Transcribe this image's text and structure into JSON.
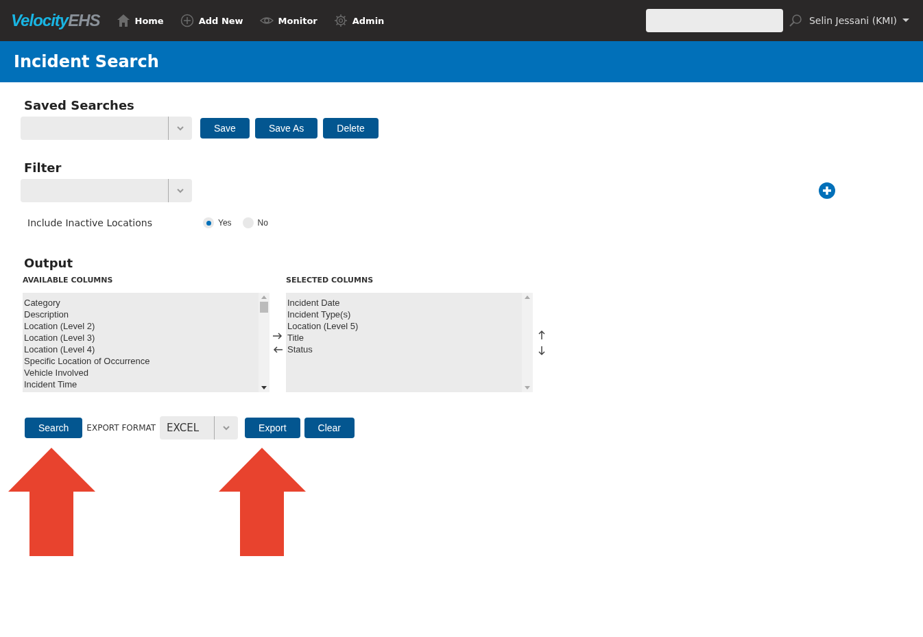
{
  "nav": {
    "logo": {
      "part_1": "Velocity",
      "part_2": "EHS"
    },
    "items": [
      {
        "label": "Home"
      },
      {
        "label": "Add New"
      },
      {
        "label": "Monitor"
      },
      {
        "label": "Admin"
      }
    ],
    "user": "Selin Jessani (KMI)"
  },
  "page_title": "Incident Search",
  "saved_searches": {
    "heading": "Saved Searches",
    "buttons": [
      "Save",
      "Save As",
      "Delete"
    ]
  },
  "filter": {
    "heading": "Filter",
    "include_inactive": {
      "label": "Include Inactive Locations",
      "options": [
        {
          "label": "Yes",
          "selected": true
        },
        {
          "label": "No",
          "selected": false
        }
      ]
    }
  },
  "output": {
    "heading": "Output",
    "available": {
      "heading": "AVAILABLE COLUMNS",
      "items": [
        "Category",
        "Description",
        "Location (Level 2)",
        "Location (Level 3)",
        "Location (Level 4)",
        "Specific Location of Occurrence",
        "Vehicle Involved",
        "Incident Time"
      ]
    },
    "selected": {
      "heading": "SELECTED COLUMNS",
      "items": [
        "Incident Date",
        "Incident Type(s)",
        "Location (Level 5)",
        "Title",
        "Status"
      ]
    }
  },
  "actions": {
    "search": "Search",
    "export_format_label": "EXPORT FORMAT",
    "export_format": "EXCEL",
    "export": "Export",
    "clear": "Clear"
  }
}
